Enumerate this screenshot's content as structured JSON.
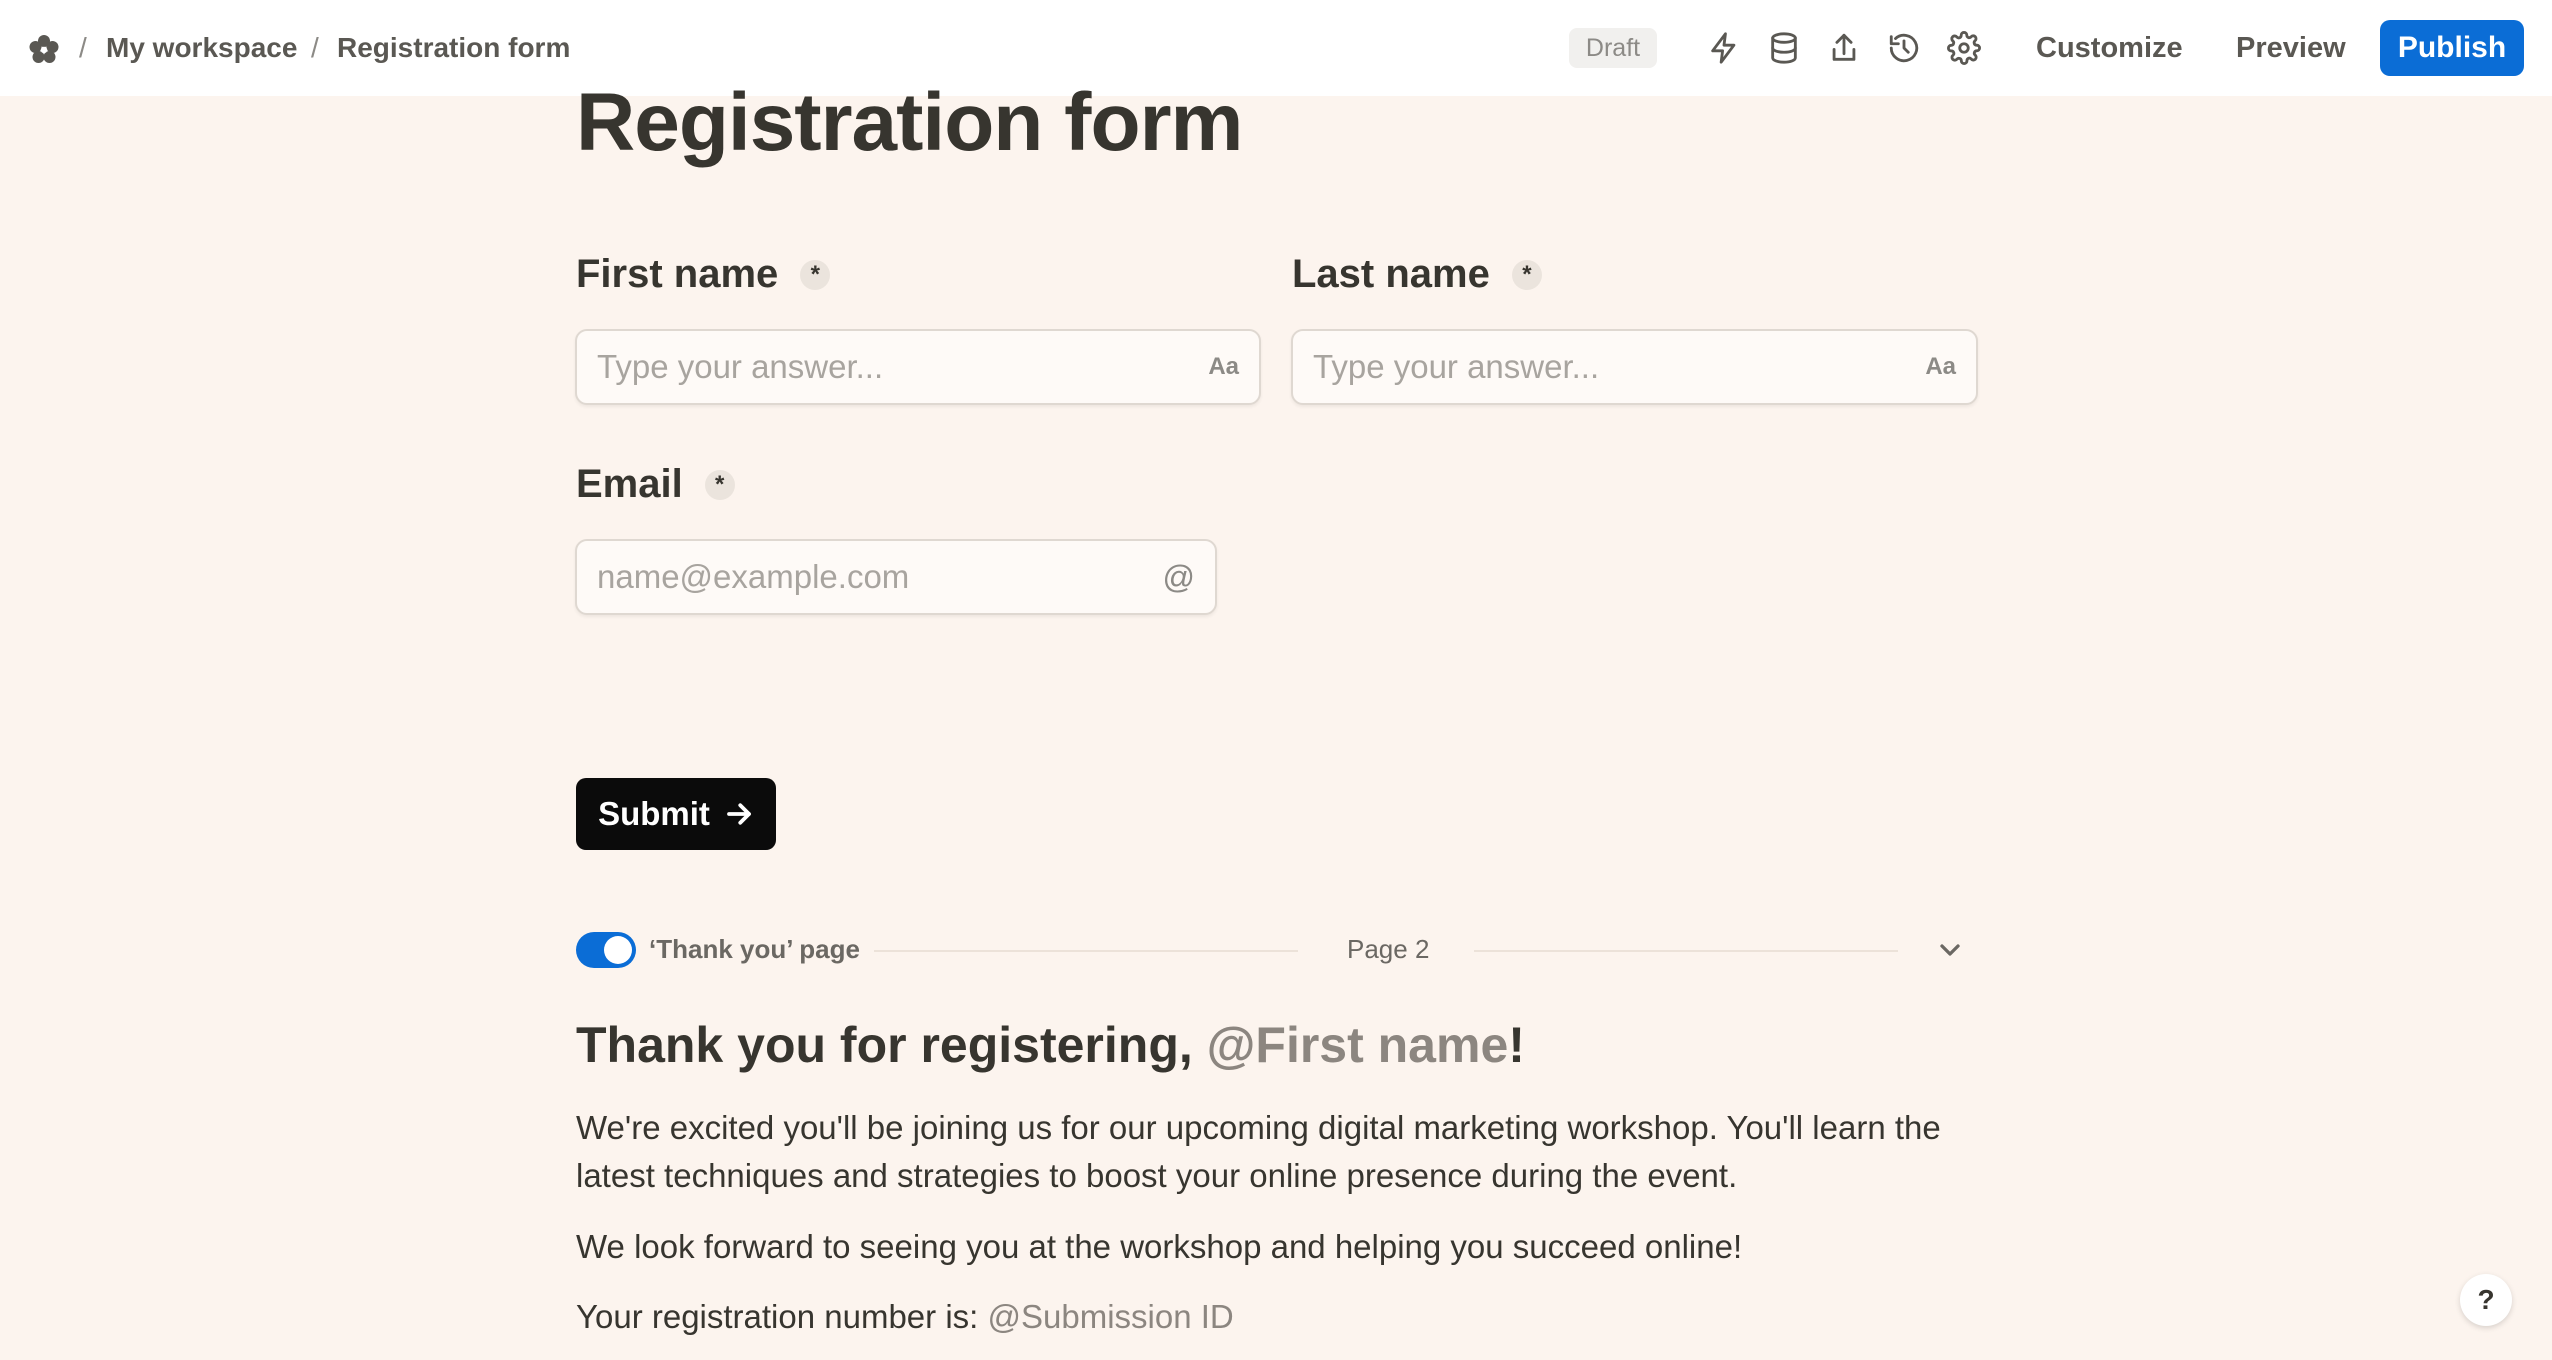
{
  "breadcrumb": {
    "workspace": "My workspace",
    "form": "Registration form",
    "separator": "/"
  },
  "toolbar": {
    "status_badge": "Draft",
    "icons": [
      "bolt-icon",
      "database-icon",
      "share-icon",
      "history-icon",
      "gear-icon"
    ],
    "customize_label": "Customize",
    "preview_label": "Preview",
    "publish_label": "Publish",
    "accent_color": "#0b6dd6"
  },
  "form": {
    "title": "Registration form",
    "required_marker": "*",
    "fields": [
      {
        "label": "First name",
        "placeholder": "Type your answer...",
        "suffix": "Aa"
      },
      {
        "label": "Last name",
        "placeholder": "Type your answer...",
        "suffix": "Aa"
      },
      {
        "label": "Email",
        "placeholder": "name@example.com",
        "suffix": "@"
      }
    ],
    "submit_label": "Submit"
  },
  "thank_you": {
    "toggle_label": "‘Thank you’ page",
    "toggle_on": true,
    "page_label": "Page 2",
    "heading_prefix": "Thank you for registering, ",
    "heading_mention": "@First name",
    "heading_suffix": "!",
    "paragraph_1": "We're excited you'll be joining us for our upcoming digital marketing workshop. You'll learn the latest techniques and strategies to boost your online presence during the event.",
    "paragraph_2": "We look forward to seeing you at the workshop and helping you succeed online!",
    "paragraph_3_prefix": "Your registration number is: ",
    "paragraph_3_mention": "@Submission ID"
  },
  "help": {
    "label": "?"
  }
}
